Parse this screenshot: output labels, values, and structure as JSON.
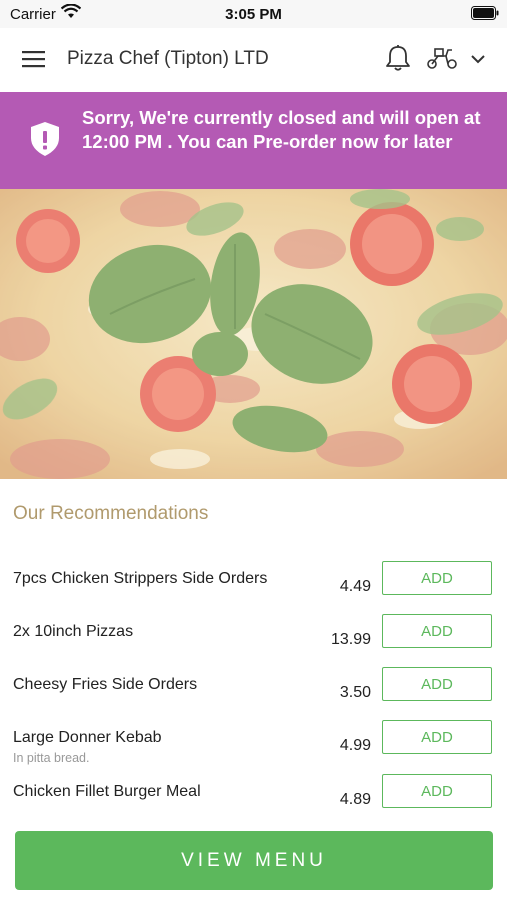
{
  "status_bar": {
    "carrier": "Carrier",
    "time": "3:05 PM"
  },
  "header": {
    "restaurant_name": "Pizza Chef (Tipton) LTD",
    "icons": [
      "menu-icon",
      "bell-icon",
      "scooter-icon",
      "chevron-down-icon"
    ]
  },
  "banner": {
    "message": "Sorry, We're currently closed and will open at 12:00 PM . You can Pre-order now for later",
    "icon": "shield-alert-icon",
    "color": "#b45ab4"
  },
  "hero": {
    "image": "pizza-photo"
  },
  "recommendations": {
    "title": "Our Recommendations",
    "add_label": "ADD",
    "items": [
      {
        "name": "7pcs Chicken Strippers Side Orders",
        "description": "",
        "price": "4.49"
      },
      {
        "name": "2x 10inch Pizzas",
        "description": "",
        "price": "13.99"
      },
      {
        "name": "Cheesy Fries Side Orders",
        "description": "",
        "price": "3.50"
      },
      {
        "name": "Large Donner Kebab",
        "description": "In pitta bread.",
        "price": "4.99"
      },
      {
        "name": "Chicken Fillet Burger Meal",
        "description": "",
        "price": "4.89"
      }
    ]
  },
  "footer": {
    "view_menu_label": "VIEW MENU",
    "accent_color": "#5cb85c"
  }
}
